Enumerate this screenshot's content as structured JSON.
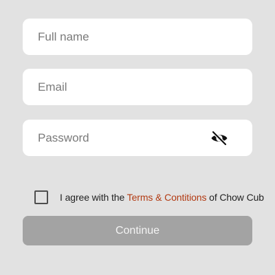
{
  "form": {
    "full_name": {
      "placeholder": "Full name",
      "value": ""
    },
    "email": {
      "placeholder": "Email",
      "value": ""
    },
    "password": {
      "placeholder": "Password",
      "value": "",
      "visibility_icon": "eye-off-icon"
    }
  },
  "terms": {
    "checked": false,
    "prefix": "I agree with the",
    "link_text": "Terms & Contitions",
    "suffix": "of Chow Cub",
    "link_color": "#b23a12"
  },
  "continue_button": {
    "label": "Continue",
    "background": "#a3a3a3",
    "enabled": false
  }
}
